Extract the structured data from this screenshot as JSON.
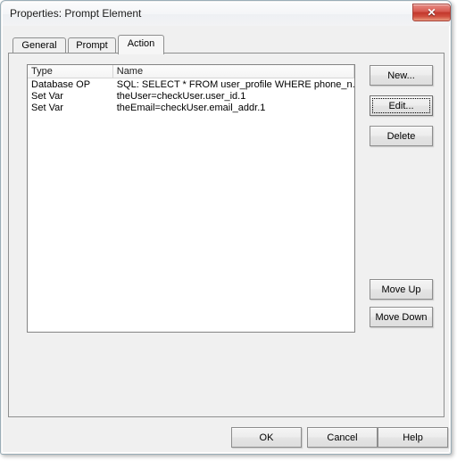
{
  "window": {
    "title": "Properties: Prompt Element",
    "close_label": "✕",
    "close_icon": "close-icon"
  },
  "tabs": [
    {
      "label": "General",
      "selected": false
    },
    {
      "label": "Prompt",
      "selected": false
    },
    {
      "label": "Action",
      "selected": true
    }
  ],
  "action_tab": {
    "list": {
      "columns": [
        "Type",
        "Name"
      ],
      "rows": [
        {
          "type": "Database OP",
          "name": "SQL: SELECT * FROM user_profile WHERE phone_n..."
        },
        {
          "type": "Set Var",
          "name": "theUser=checkUser.user_id.1"
        },
        {
          "type": "Set Var",
          "name": "theEmail=checkUser.email_addr.1"
        }
      ]
    },
    "side_buttons": {
      "new": "New...",
      "edit": "Edit...",
      "delete": "Delete",
      "move_up": "Move Up",
      "move_down": "Move Down"
    }
  },
  "footer": {
    "ok": "OK",
    "cancel": "Cancel",
    "help": "Help"
  },
  "colors": {
    "dialog_face": "#f0f0f0",
    "list_background": "#ffffff",
    "close_button": "#c3362c",
    "border": "#8e8f8f"
  }
}
